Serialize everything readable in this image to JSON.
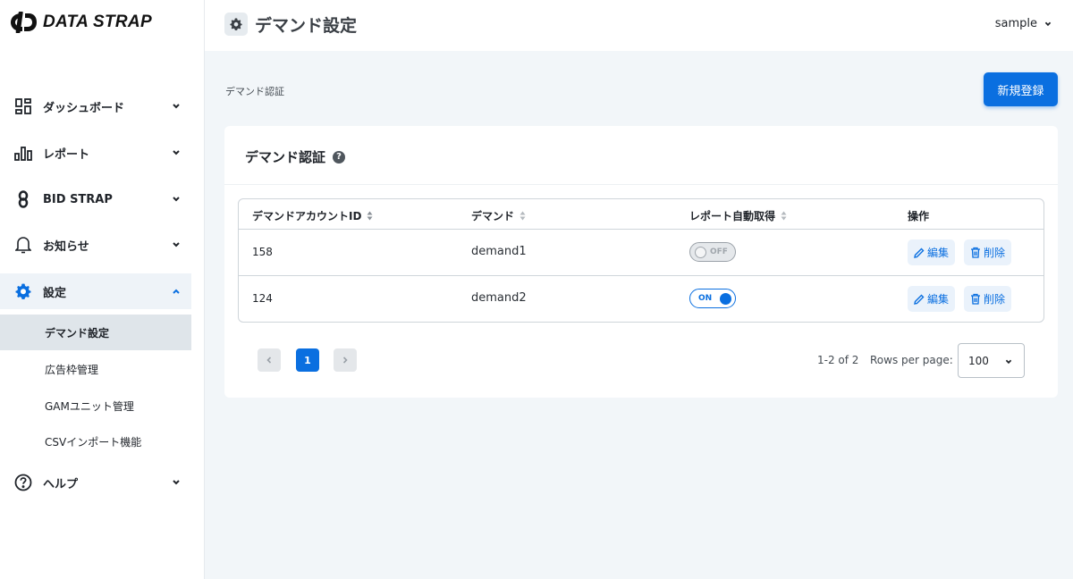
{
  "brand": {
    "name": "DATA STRAP"
  },
  "sidebar": {
    "items": [
      {
        "label": "ダッシュボード",
        "icon": "dashboard-icon"
      },
      {
        "label": "レポート",
        "icon": "bar-chart-icon"
      },
      {
        "label": "BID STRAP",
        "icon": "link-icon"
      },
      {
        "label": "お知らせ",
        "icon": "bell-icon"
      },
      {
        "label": "設定",
        "icon": "gear-icon",
        "expanded": true
      },
      {
        "label": "ヘルプ",
        "icon": "help-circle-icon"
      }
    ],
    "settings_sub": [
      {
        "label": "デマンド設定",
        "selected": true
      },
      {
        "label": "広告枠管理"
      },
      {
        "label": "GAMユニット管理"
      },
      {
        "label": "CSVインポート機能"
      }
    ]
  },
  "header": {
    "title": "デマンド設定",
    "user": "sample"
  },
  "main": {
    "breadcrumb": "デマンド認証",
    "new_button": "新規登録",
    "card_title": "デマンド認証",
    "help_glyph": "?",
    "table": {
      "columns": [
        "デマンドアカウントID",
        "デマンド",
        "レポート自動取得",
        "操作"
      ],
      "rows": [
        {
          "id": "158",
          "demand": "demand1",
          "auto": "OFF",
          "auto_on": false
        },
        {
          "id": "124",
          "demand": "demand2",
          "auto": "ON",
          "auto_on": true
        }
      ],
      "edit_label": "編集",
      "delete_label": "削除"
    },
    "pagination": {
      "current_page": "1",
      "range": "1-2 of 2",
      "rows_per_page_label": "Rows per page:",
      "rows_per_page": "100"
    }
  },
  "colors": {
    "primary": "#0a6fe0",
    "sidebar_selected": "#dfe5ea",
    "background": "#f2f6f9"
  }
}
